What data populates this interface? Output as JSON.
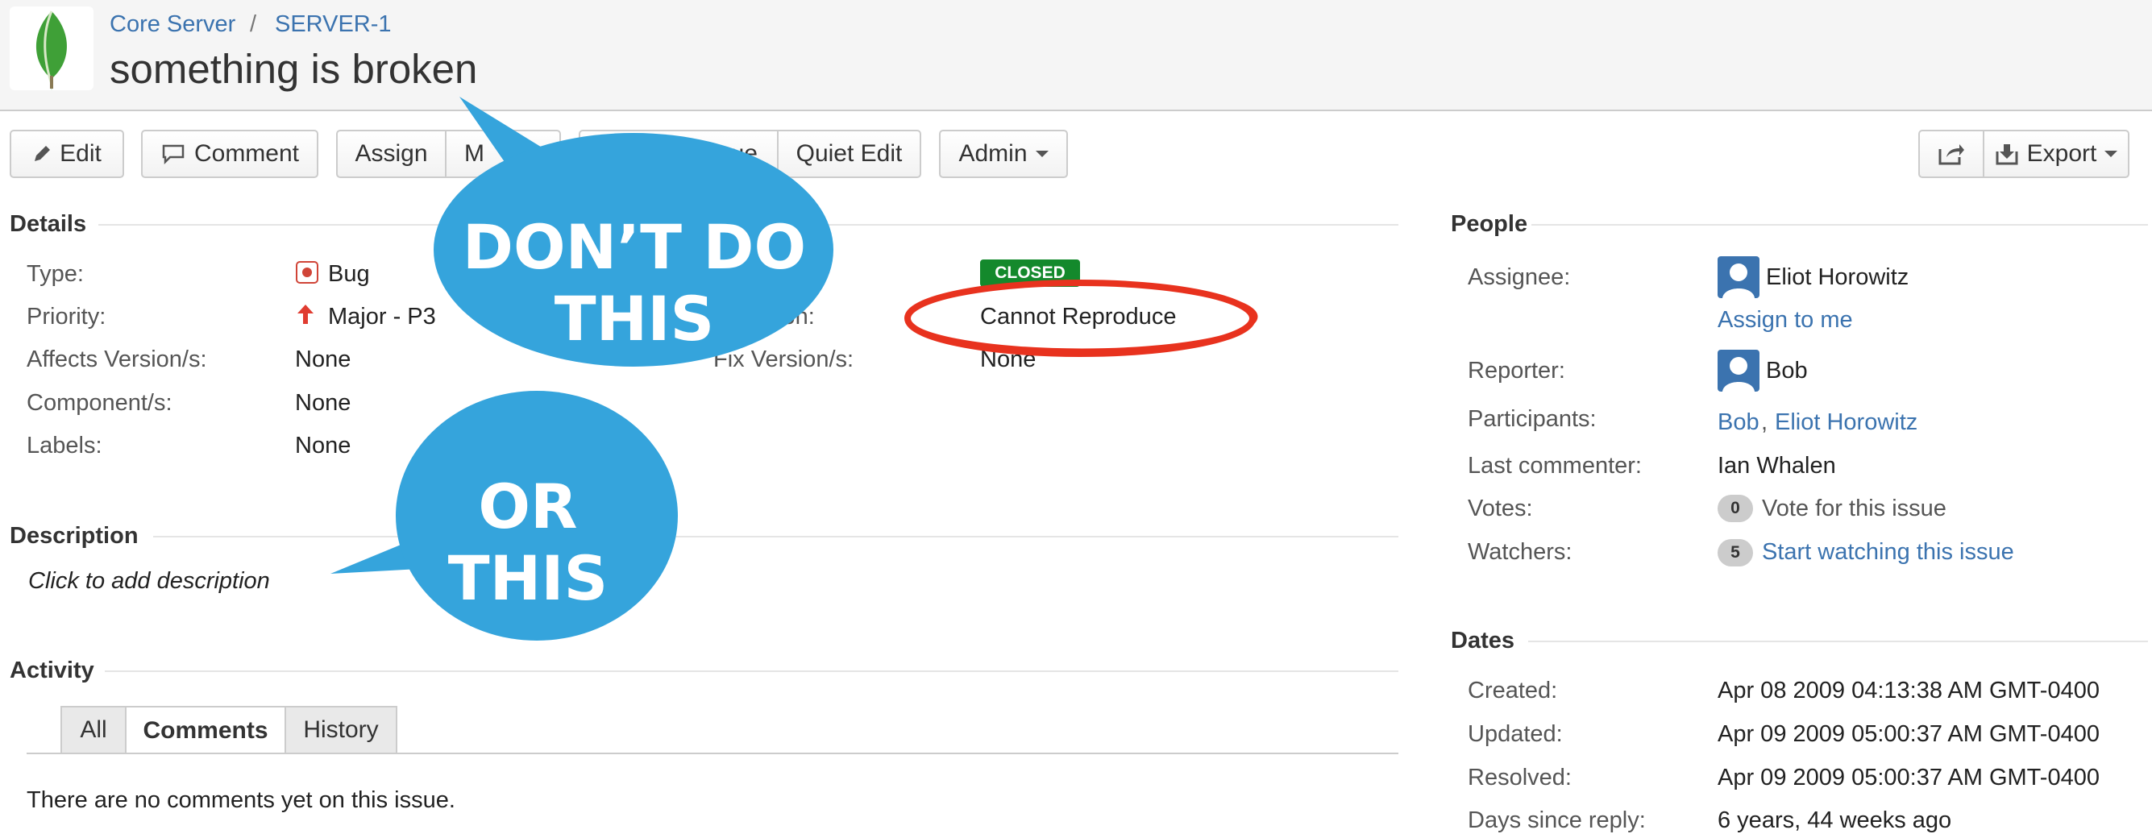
{
  "breadcrumb": {
    "project": "Core Server",
    "separator": "/",
    "issue_key": "SERVER-1"
  },
  "issue": {
    "summary": "something is broken"
  },
  "toolbar": {
    "edit": "Edit",
    "comment": "Comment",
    "assign": "Assign",
    "more": "M",
    "resolve_partial": "ue",
    "quiet_edit": "Quiet Edit",
    "admin": "Admin",
    "export": "Export"
  },
  "details": {
    "heading": "Details",
    "type_label": "Type:",
    "type_value": "Bug",
    "priority_label": "Priority:",
    "priority_value": "Major - P3",
    "affects_label": "Affects Version/s:",
    "affects_value": "None",
    "component_label": "Component/s:",
    "component_value": "None",
    "labels_label": "Labels:",
    "labels_value": "None",
    "status_value": "CLOSED",
    "resolution_label": "ion:",
    "resolution_value": "Cannot Reproduce",
    "fix_label": "Fix Version/s:",
    "fix_value": "None"
  },
  "description": {
    "heading": "Description",
    "placeholder": "Click to add description"
  },
  "activity": {
    "heading": "Activity",
    "tabs": [
      "All",
      "Comments",
      "History"
    ],
    "active_tab": "Comments",
    "empty_message": "There are no comments yet on this issue."
  },
  "people": {
    "heading": "People",
    "assignee_label": "Assignee:",
    "assignee": "Eliot Horowitz",
    "assign_to_me": "Assign to me",
    "reporter_label": "Reporter:",
    "reporter": "Bob",
    "participants_label": "Participants:",
    "participant_1": "Bob",
    "participant_sep": ",",
    "participant_2": "Eliot Horowitz",
    "last_commenter_label": "Last commenter:",
    "last_commenter": "Ian Whalen",
    "votes_label": "Votes:",
    "votes_count": "0",
    "vote_link": "Vote for this issue",
    "watchers_label": "Watchers:",
    "watchers_count": "5",
    "watch_link": "Start watching this issue"
  },
  "dates": {
    "heading": "Dates",
    "created_label": "Created:",
    "created": "Apr 08 2009 04:13:38 AM GMT-0400",
    "updated_label": "Updated:",
    "updated": "Apr 09 2009 05:00:37 AM GMT-0400",
    "resolved_label": "Resolved:",
    "resolved": "Apr 09 2009 05:00:37 AM GMT-0400",
    "days_label": "Days since reply:",
    "days": "6 years, 44 weeks ago"
  },
  "annotations": {
    "bubble_1": "DON’T DO THIS",
    "bubble_2": "OR THIS"
  },
  "colors": {
    "bubble": "#35a4dc",
    "circle": "#e8321e",
    "link": "#3b73af",
    "closed": "#14892c"
  }
}
